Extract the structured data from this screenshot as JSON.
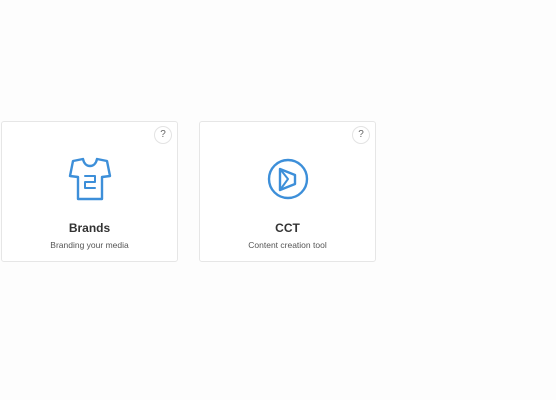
{
  "cards": [
    {
      "title": "Brands",
      "description": "Branding your media",
      "icon": "tshirt-icon",
      "help": "?"
    },
    {
      "title": "CCT",
      "description": "Content creation tool",
      "icon": "cct-logo-icon",
      "help": "?"
    }
  ],
  "colors": {
    "accent": "#3d8fd9",
    "card_border": "#e6e6e6",
    "background": "#fdfdfd"
  }
}
